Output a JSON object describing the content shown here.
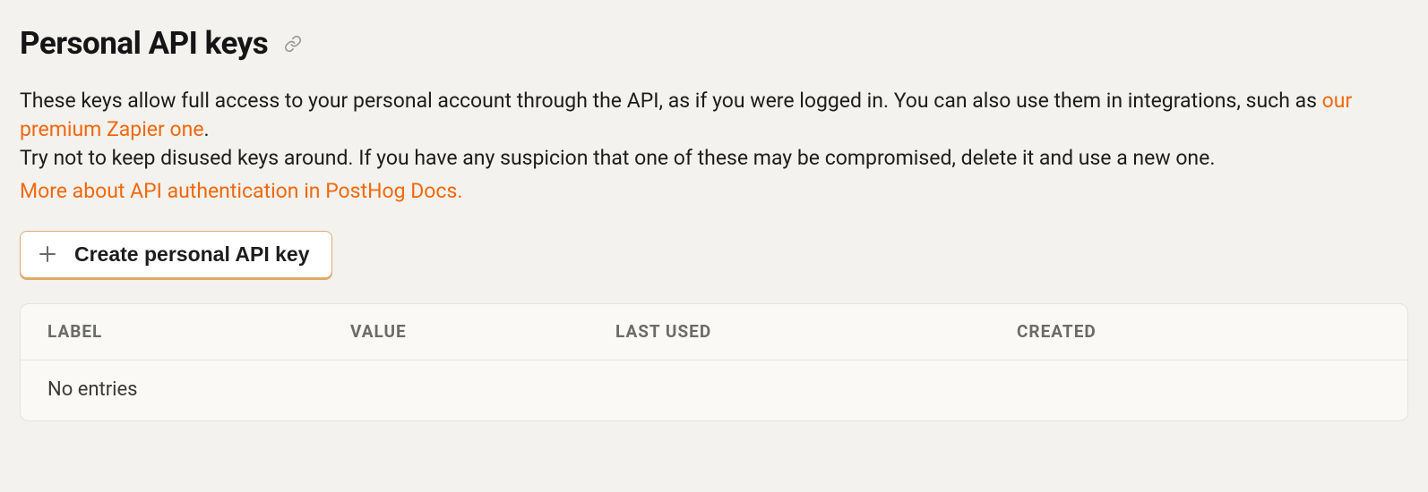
{
  "title": "Personal API keys",
  "description": {
    "line1_before": "These keys allow full access to your personal account through the API, as if you were logged in. You can also use them in integrations, such as ",
    "zapier_link": "our premium Zapier one",
    "line1_after": ".",
    "line2": "Try not to keep disused keys around. If you have any suspicion that one of these may be compromised, delete it and use a new one."
  },
  "docs_link": "More about API authentication in PostHog Docs.",
  "create_button": "Create personal API key",
  "table": {
    "headers": {
      "label": "Label",
      "value": "Value",
      "last_used": "Last Used",
      "created": "Created"
    },
    "empty": "No entries"
  }
}
